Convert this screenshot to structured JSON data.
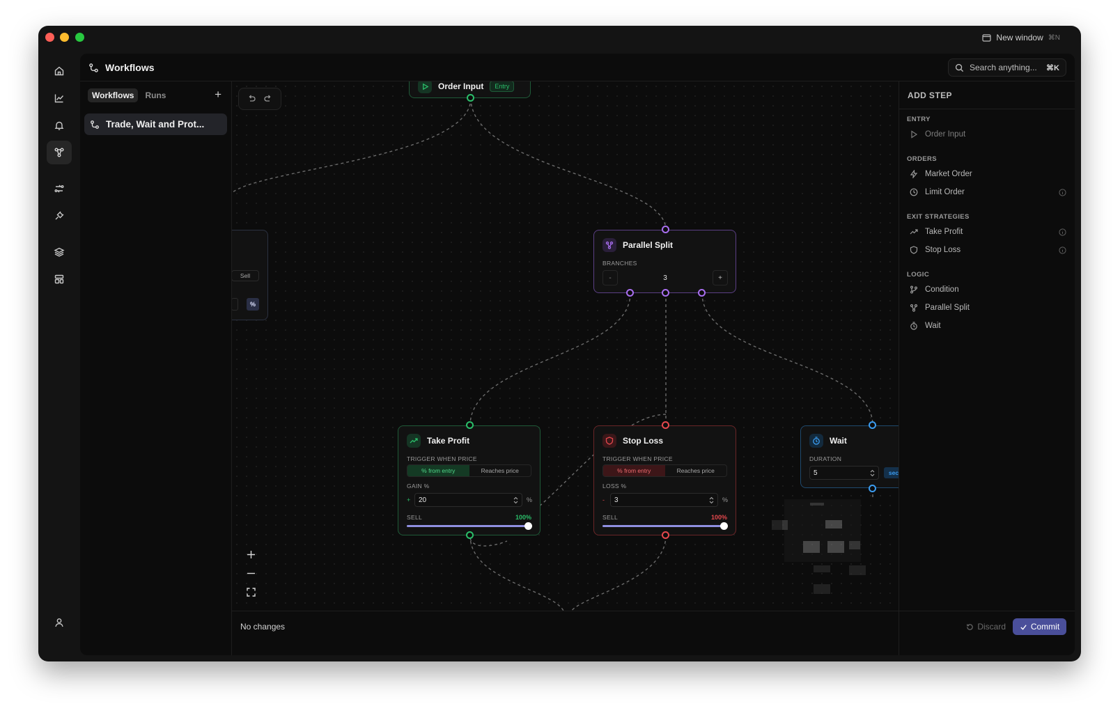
{
  "window": {
    "new_window_label": "New window",
    "new_window_shortcut": "⌘N"
  },
  "header": {
    "title": "Workflows",
    "search_placeholder": "Search anything...",
    "search_shortcut": "⌘K"
  },
  "sidebar": {
    "tabs": [
      {
        "label": "Workflows",
        "active": true
      },
      {
        "label": "Runs",
        "active": false
      }
    ],
    "add_label": "+",
    "workflows": [
      {
        "label": "Trade, Wait and Prot..."
      }
    ]
  },
  "nav": [
    {
      "icon": "home-icon"
    },
    {
      "icon": "chart-icon"
    },
    {
      "icon": "bell-icon"
    },
    {
      "icon": "workflow-icon",
      "active": true
    },
    {
      "icon": "strategy-icon"
    },
    {
      "icon": "plug-icon"
    },
    {
      "icon": "layers-icon"
    },
    {
      "icon": "layout-icon"
    },
    {
      "icon": "user-icon"
    }
  ],
  "canvas": {
    "partial_node": {
      "side_label": "Sell",
      "unit": "%"
    },
    "nodes": {
      "order_input": {
        "title": "Order Input",
        "badge": "Entry"
      },
      "parallel_split": {
        "title": "Parallel Split",
        "branches_label": "BRANCHES",
        "branches_value": "3",
        "minus": "-",
        "plus": "+"
      },
      "take_profit": {
        "title": "Take Profit",
        "trigger_label": "TRIGGER WHEN PRICE",
        "options": [
          "% from entry",
          "Reaches price"
        ],
        "value_label": "GAIN %",
        "sign": "+",
        "value": "20",
        "unit": "%",
        "sell_label": "SELL",
        "sell_value": "100%",
        "sell_fraction": 1.0
      },
      "stop_loss": {
        "title": "Stop Loss",
        "trigger_label": "TRIGGER WHEN PRICE",
        "options": [
          "% from entry",
          "Reaches price"
        ],
        "value_label": "LOSS %",
        "sign": "-",
        "value": "3",
        "unit": "%",
        "sell_label": "SELL",
        "sell_value": "100%",
        "sell_fraction": 1.0
      },
      "wait": {
        "title": "Wait",
        "duration_label": "DURATION",
        "value": "5",
        "unit": "sec"
      }
    },
    "colors": {
      "entry": "#2bbf6a",
      "split": "#a96ff0",
      "profit": "#2bbf6a",
      "loss": "#e5484d",
      "wait": "#3b9cf0"
    }
  },
  "footer": {
    "status": "No changes",
    "discard_label": "Discard",
    "commit_label": "Commit"
  },
  "add_step": {
    "title": "ADD STEP",
    "groups": [
      {
        "label": "ENTRY",
        "items": [
          {
            "label": "Order Input",
            "icon": "play-icon",
            "info": false
          }
        ]
      },
      {
        "label": "ORDERS",
        "items": [
          {
            "label": "Market Order",
            "icon": "lightning-icon",
            "info": false
          },
          {
            "label": "Limit Order",
            "icon": "clock-icon",
            "info": true
          }
        ]
      },
      {
        "label": "EXIT STRATEGIES",
        "items": [
          {
            "label": "Take Profit",
            "icon": "trend-up-icon",
            "info": true
          },
          {
            "label": "Stop Loss",
            "icon": "shield-icon",
            "info": true
          }
        ]
      },
      {
        "label": "LOGIC",
        "items": [
          {
            "label": "Condition",
            "icon": "branch-icon",
            "info": false
          },
          {
            "label": "Parallel Split",
            "icon": "split-icon",
            "info": false
          },
          {
            "label": "Wait",
            "icon": "timer-icon",
            "info": false
          }
        ]
      }
    ]
  }
}
